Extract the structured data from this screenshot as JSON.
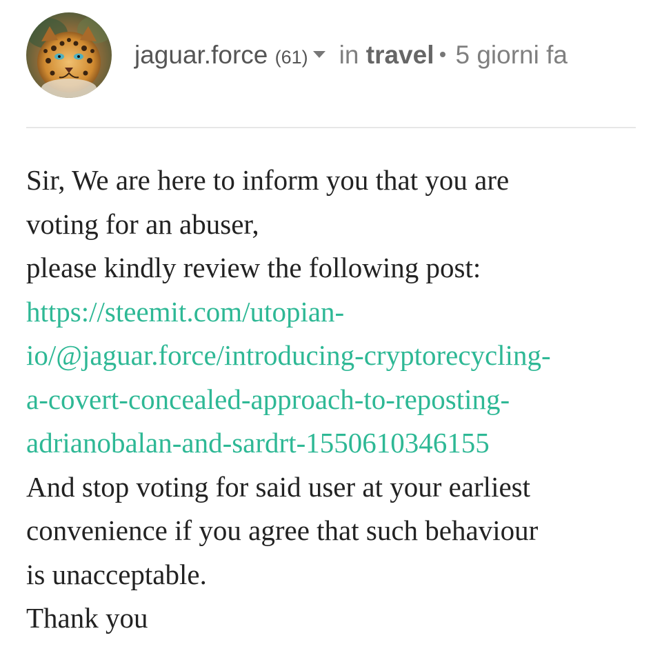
{
  "post": {
    "author": "jaguar.force",
    "reputation": "(61)",
    "category_prefix": "in",
    "category": "travel",
    "time_ago": "5 giorni fa"
  },
  "icons": {
    "avatar": "jaguar-avatar",
    "author_menu": "caret-down-icon"
  },
  "colors": {
    "link": "#2eb895",
    "body_text": "#222222",
    "meta_text": "#7f7f7f",
    "divider": "#e6e6e6"
  },
  "body": {
    "lines": [
      "Sir, We are here to inform you that you are",
      "voting for an abuser,",
      "please kindly review the following post:"
    ],
    "link_lines": [
      "https://steemit.com/utopian-",
      "io/@jaguar.force/introducing-cryptorecycling-",
      "a-covert-concealed-approach-to-reposting-",
      "adrianobalan-and-sardrt-1550610346155"
    ],
    "closing_lines": [
      "And stop voting for said user at your earliest",
      "convenience if you agree that such behaviour",
      "is unacceptable.",
      "Thank you"
    ]
  }
}
